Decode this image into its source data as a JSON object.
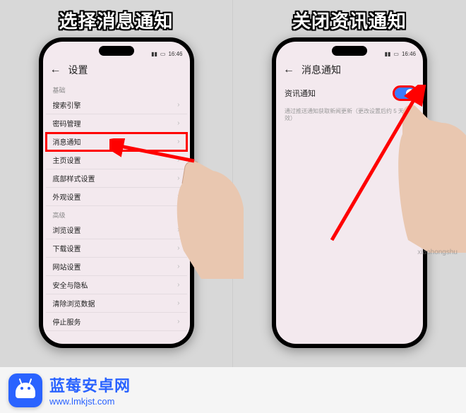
{
  "captions": {
    "left": "选择消息通知",
    "right": "关闭资讯通知"
  },
  "status": {
    "signal_icon": "signal-icon",
    "battery_icon": "battery-icon",
    "time": "16:46"
  },
  "left_screen": {
    "header_title": "设置",
    "sections": [
      {
        "label": "基础",
        "items": [
          {
            "label": "搜索引擎",
            "highlight": false
          },
          {
            "label": "密码管理",
            "highlight": false
          },
          {
            "label": "消息通知",
            "highlight": true
          },
          {
            "label": "主页设置",
            "highlight": false
          },
          {
            "label": "底部样式设置",
            "highlight": false
          },
          {
            "label": "外观设置",
            "highlight": false
          }
        ]
      },
      {
        "label": "高级",
        "items": [
          {
            "label": "浏览设置",
            "highlight": false
          },
          {
            "label": "下载设置",
            "highlight": false
          },
          {
            "label": "网站设置",
            "highlight": false
          },
          {
            "label": "安全与隐私",
            "highlight": false
          },
          {
            "label": "清除浏览数据",
            "highlight": false
          },
          {
            "label": "停止服务",
            "highlight": false
          }
        ]
      }
    ]
  },
  "right_screen": {
    "header_title": "消息通知",
    "toggle_label": "资讯通知",
    "toggle_on": true,
    "description": "通过推送通知获取新闻更新（更改设置后约 5 天生效）"
  },
  "watermark_text": "xiaohongshu",
  "footer": {
    "title": "蓝莓安卓网",
    "url": "www.lmkjst.com"
  }
}
